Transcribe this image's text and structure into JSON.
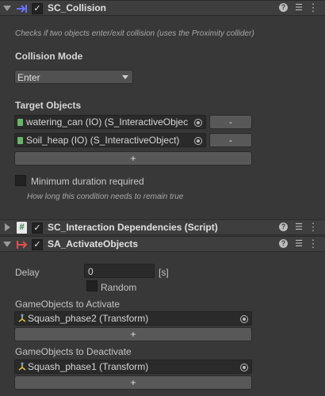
{
  "sc_collision": {
    "title": "SC_Collision",
    "description": "Checks if two objects enter/exit collision (uses the Proximity collider)",
    "mode_label": "Collision Mode",
    "mode_value": "Enter",
    "targets_label": "Target Objects",
    "targets": [
      {
        "name": "watering_can (IO) (S_InteractiveObjec",
        "remove": "-"
      },
      {
        "name": "Soil_heap (IO) (S_InteractiveObject)",
        "remove": "-"
      }
    ],
    "add_label": "+",
    "min_duration_label": "Minimum duration required",
    "min_duration_hint": "How long this condition needs to remain true"
  },
  "sc_dependencies": {
    "title": "SC_Interaction Dependencies (Script)"
  },
  "sa_activate": {
    "title": "SA_ActivateObjects",
    "delay_label": "Delay",
    "delay_value": "0",
    "delay_unit": "[s]",
    "random_label": "Random",
    "activate_label": "GameObjects to Activate",
    "activate_item": "Squash_phase2 (Transform)",
    "activate_add": "+",
    "deactivate_label": "GameObjects to Deactivate",
    "deactivate_item": "Squash_phase1 (Transform)",
    "deactivate_add": "+"
  },
  "icons": {
    "help": "help-icon",
    "settings": "sliders-icon",
    "menu": "kebab-menu-icon"
  }
}
